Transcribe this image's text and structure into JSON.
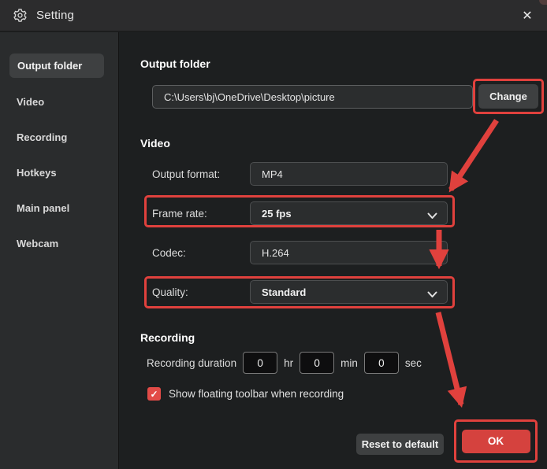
{
  "window": {
    "title": "Setting"
  },
  "icons": {
    "gear": "gear-icon",
    "close": "✕",
    "checkmark": "✓",
    "chevron_down": "chevron-down"
  },
  "sidebar": {
    "items": [
      {
        "label": "Output folder",
        "selected": true
      },
      {
        "label": "Video",
        "selected": false
      },
      {
        "label": "Recording",
        "selected": false
      },
      {
        "label": "Hotkeys",
        "selected": false
      },
      {
        "label": "Main panel",
        "selected": false
      },
      {
        "label": "Webcam",
        "selected": false
      }
    ]
  },
  "main": {
    "output_folder": {
      "heading": "Output folder",
      "path": "C:\\Users\\bj\\OneDrive\\Desktop\\picture",
      "change_label": "Change"
    },
    "video": {
      "heading": "Video",
      "output_format": {
        "label": "Output format:",
        "value": "MP4"
      },
      "frame_rate": {
        "label": "Frame rate:",
        "value": "25 fps"
      },
      "codec": {
        "label": "Codec:",
        "value": "H.264"
      },
      "quality": {
        "label": "Quality:",
        "value": "Standard"
      }
    },
    "recording": {
      "heading": "Recording",
      "duration_label": "Recording duration",
      "hours": "0",
      "minutes": "0",
      "seconds": "0",
      "units": [
        "hr",
        "min",
        "sec"
      ],
      "checkbox_label": "Show floating toolbar when recording",
      "checkbox_checked": true
    },
    "footer": {
      "reset_label": "Reset to default",
      "ok_label": "OK"
    }
  },
  "annotations": {
    "highlighted_elements": [
      "Change button",
      "Frame rate row",
      "Quality row",
      "OK button"
    ],
    "arrow_color": "#e0413d"
  },
  "colors": {
    "accent_red": "#e0413d",
    "ok_button_red": "#d5423e",
    "checkbox_red": "#e24b47",
    "titlebar_bg": "#2c2c2d",
    "sidebar_bg": "#2a2c2d",
    "content_bg": "#1d1f20",
    "field_bg": "#2b2d2e",
    "selected_item_bg": "#3e4041"
  }
}
